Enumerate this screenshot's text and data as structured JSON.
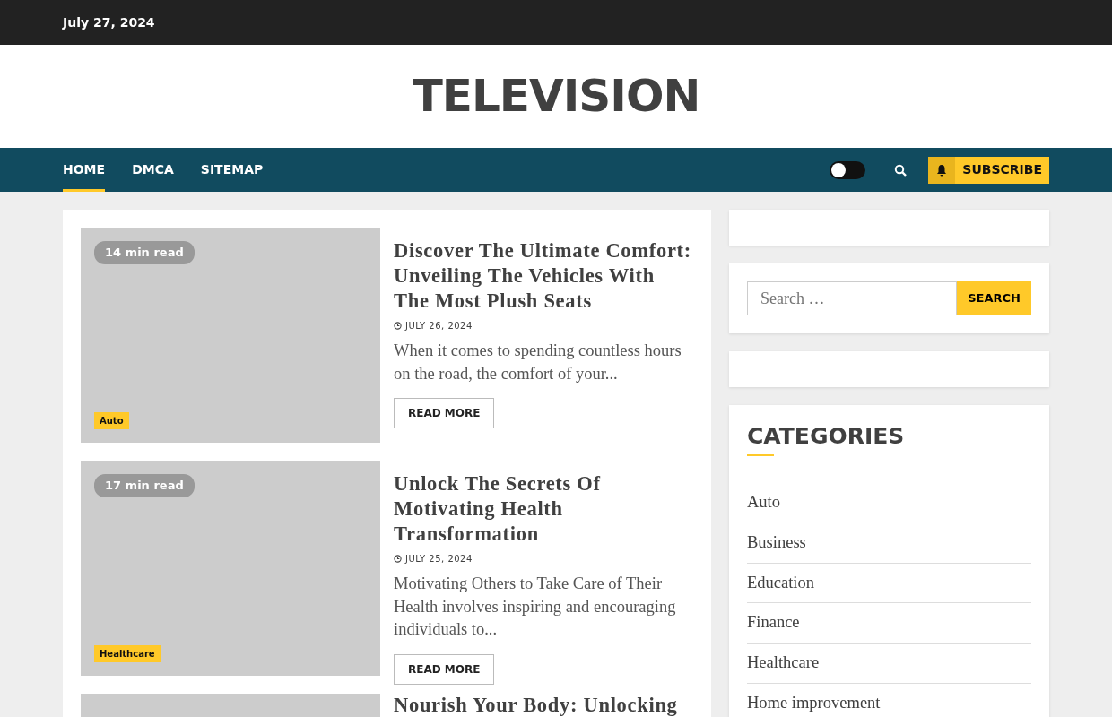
{
  "top_bar": {
    "date": "July 27, 2024"
  },
  "site_title": "TELEVISION",
  "nav": {
    "items": [
      {
        "label": "HOME",
        "selected": true
      },
      {
        "label": "DMCA",
        "selected": false
      },
      {
        "label": "SITEMAP",
        "selected": false
      }
    ],
    "dark_mode_toggle": {
      "on": false
    },
    "subscribe_button": "SUBSCRIBE"
  },
  "posts": [
    {
      "read_time": "14 min read",
      "category": "Auto",
      "title": "Discover The Ultimate Comfort: Unveiling The Vehicles With The Most Plush Seats",
      "date": "JULY 26, 2024",
      "excerpt": "When it comes to spending countless hours on the road, the comfort of your...",
      "button": "READ MORE"
    },
    {
      "read_time": "17 min read",
      "category": "Healthcare",
      "title": "Unlock The Secrets Of Motivating Health Transformation",
      "date": "JULY 25, 2024",
      "excerpt": "Motivating Others to Take Care of Their Health involves inspiring and encouraging individuals to...",
      "button": "READ MORE"
    },
    {
      "title": "Nourish Your Body: Unlocking"
    }
  ],
  "sidebar": {
    "search": {
      "placeholder": "Search …",
      "button": "SEARCH"
    },
    "categories": {
      "title": "CATEGORIES",
      "items": [
        "Auto",
        "Business",
        "Education",
        "Finance",
        "Healthcare",
        "Home improvement"
      ]
    }
  }
}
